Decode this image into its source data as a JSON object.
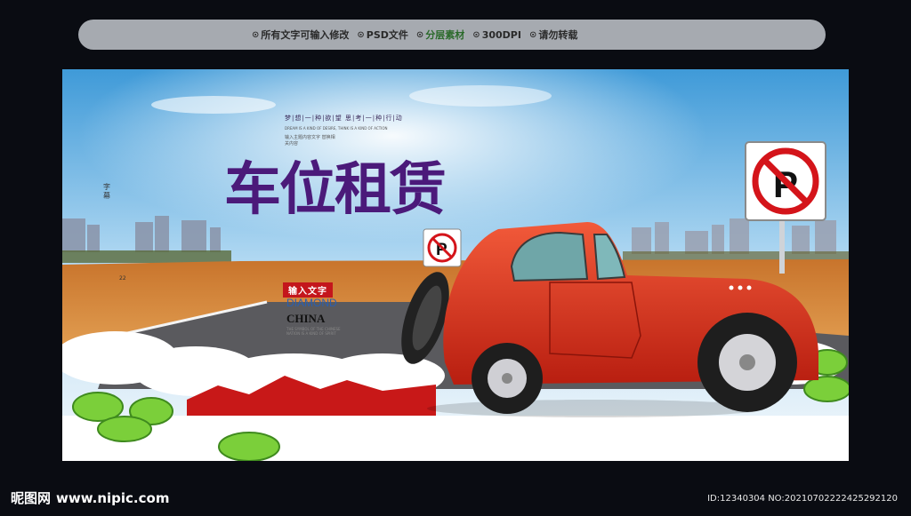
{
  "topbar": {
    "items": [
      {
        "icon": "circle-dot-icon",
        "text": "所有文字可输入修改"
      },
      {
        "icon": "circle-dot-icon",
        "text": "PSD文件"
      },
      {
        "icon": "circle-dot-icon",
        "text": "分层素材"
      },
      {
        "icon": "circle-dot-icon",
        "text": "300DPI"
      },
      {
        "icon": "circle-dot-icon",
        "text": "请勿转载"
      }
    ]
  },
  "poster": {
    "slogan": "梦|想|一|种|欲|望  思|考|一|种|行|动",
    "slogan_en": "DREAM IS A KIND OF DESIRE, THINK IS A KIND OF ACTION",
    "small_text": "输入主题内容文字 替换相关内容",
    "title": "车位租赁",
    "vertical_chars": "字 幕",
    "vertical_number": "22",
    "red_tag": "输入文字",
    "diamond": "DIAMOND",
    "china": "CHINA",
    "fine_print": "THE SYMBOL OF THE CHINESE NATION IS A KIND OF SPIRIT"
  },
  "footer": {
    "logo": "昵图网",
    "url": "www.nipic.com",
    "id_text": "ID:12340304 NO:20210702222425292120"
  },
  "colors": {
    "title": "#4b1a7a",
    "car": "#e0331f",
    "sky": "#6fb8e8",
    "ground": "#d9883a"
  }
}
